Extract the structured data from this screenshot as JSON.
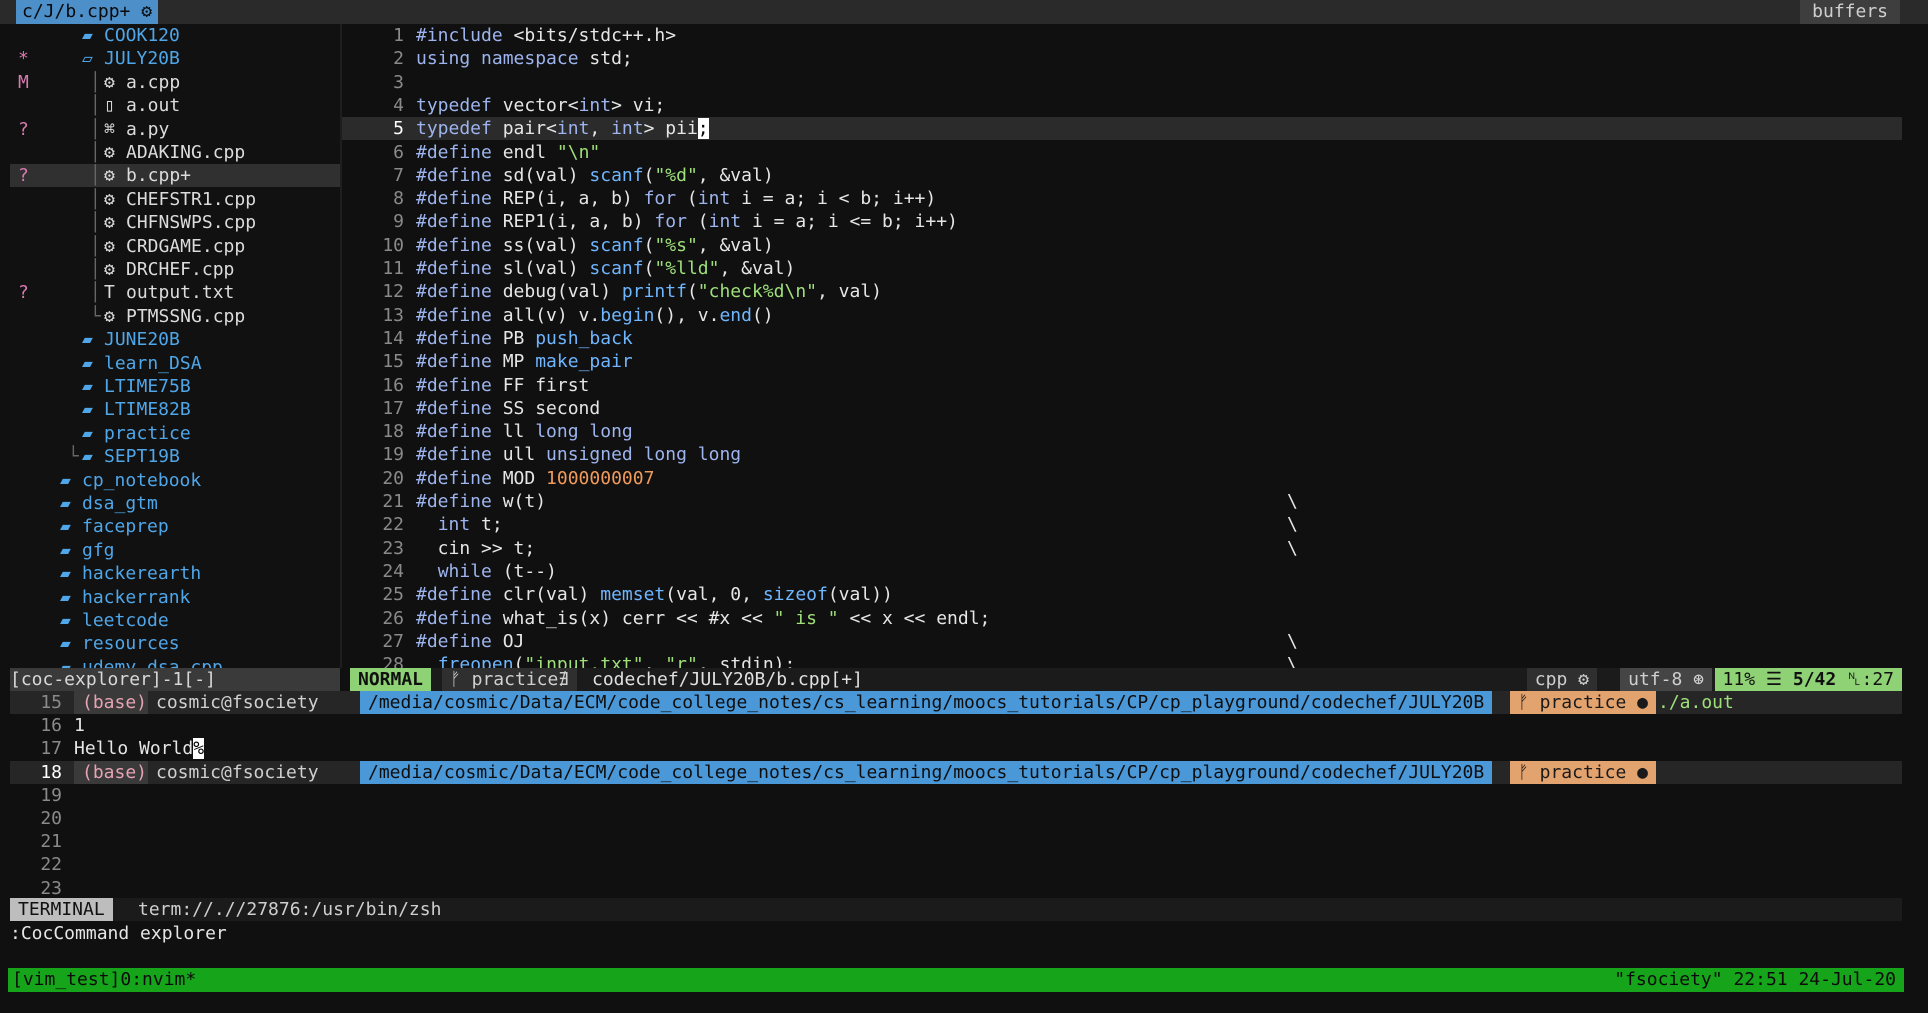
{
  "tabline": {
    "active_tab": "c/J/b.cpp+",
    "right_label": "buffers"
  },
  "explorer": {
    "rows": [
      {
        "flag": "",
        "indent": 2,
        "guide": "",
        "icon": "folder",
        "name": "COOK120",
        "selected": false
      },
      {
        "flag": "*",
        "indent": 2,
        "guide": "",
        "icon": "folder-open",
        "name": "JULY20B",
        "selected": false
      },
      {
        "flag": "M",
        "indent": 3,
        "guide": "│",
        "icon": "cpp",
        "name": "a.cpp",
        "selected": false
      },
      {
        "flag": "",
        "indent": 3,
        "guide": "│",
        "icon": "file",
        "name": "a.out",
        "selected": false
      },
      {
        "flag": "?",
        "indent": 3,
        "guide": "│",
        "icon": "python",
        "name": "a.py",
        "selected": false
      },
      {
        "flag": "",
        "indent": 3,
        "guide": "│",
        "icon": "cpp",
        "name": "ADAKING.cpp",
        "selected": false
      },
      {
        "flag": "?",
        "indent": 3,
        "guide": "│",
        "icon": "cpp",
        "name": "b.cpp+",
        "selected": true
      },
      {
        "flag": "",
        "indent": 3,
        "guide": "│",
        "icon": "cpp",
        "name": "CHEFSTR1.cpp",
        "selected": false
      },
      {
        "flag": "",
        "indent": 3,
        "guide": "│",
        "icon": "cpp",
        "name": "CHFNSWPS.cpp",
        "selected": false
      },
      {
        "flag": "",
        "indent": 3,
        "guide": "│",
        "icon": "cpp",
        "name": "CRDGAME.cpp",
        "selected": false
      },
      {
        "flag": "",
        "indent": 3,
        "guide": "│",
        "icon": "cpp",
        "name": "DRCHEF.cpp",
        "selected": false
      },
      {
        "flag": "?",
        "indent": 3,
        "guide": "│",
        "icon": "text",
        "name": "output.txt",
        "selected": false
      },
      {
        "flag": "",
        "indent": 3,
        "guide": "└",
        "icon": "cpp",
        "name": "PTMSSNG.cpp",
        "selected": false
      },
      {
        "flag": "",
        "indent": 2,
        "guide": "",
        "icon": "folder",
        "name": "JUNE20B",
        "selected": false
      },
      {
        "flag": "",
        "indent": 2,
        "guide": "",
        "icon": "folder",
        "name": "learn_DSA",
        "selected": false
      },
      {
        "flag": "",
        "indent": 2,
        "guide": "",
        "icon": "folder",
        "name": "LTIME75B",
        "selected": false
      },
      {
        "flag": "",
        "indent": 2,
        "guide": "",
        "icon": "folder",
        "name": "LTIME82B",
        "selected": false
      },
      {
        "flag": "",
        "indent": 2,
        "guide": "",
        "icon": "folder",
        "name": "practice",
        "selected": false
      },
      {
        "flag": "",
        "indent": 2,
        "guide": "└",
        "icon": "folder",
        "name": "SEPT19B",
        "selected": false
      },
      {
        "flag": "",
        "indent": 1,
        "guide": "",
        "icon": "folder",
        "name": "cp_notebook",
        "selected": false
      },
      {
        "flag": "",
        "indent": 1,
        "guide": "",
        "icon": "folder",
        "name": "dsa_gtm",
        "selected": false
      },
      {
        "flag": "",
        "indent": 1,
        "guide": "",
        "icon": "folder",
        "name": "faceprep",
        "selected": false
      },
      {
        "flag": "",
        "indent": 1,
        "guide": "",
        "icon": "folder",
        "name": "gfg",
        "selected": false
      },
      {
        "flag": "",
        "indent": 1,
        "guide": "",
        "icon": "folder",
        "name": "hackerearth",
        "selected": false
      },
      {
        "flag": "",
        "indent": 1,
        "guide": "",
        "icon": "folder",
        "name": "hackerrank",
        "selected": false
      },
      {
        "flag": "",
        "indent": 1,
        "guide": "",
        "icon": "folder",
        "name": "leetcode",
        "selected": false
      },
      {
        "flag": "",
        "indent": 1,
        "guide": "",
        "icon": "folder",
        "name": "resources",
        "selected": false
      },
      {
        "flag": "",
        "indent": 1,
        "guide": "",
        "icon": "folder",
        "name": "udemy_dsa_cpp",
        "selected": false
      }
    ]
  },
  "editor": {
    "current_line": 5,
    "lines": [
      {
        "n": 1,
        "text": "#include <bits/stdc++.h>",
        "bs": ""
      },
      {
        "n": 2,
        "text": "using namespace std;",
        "bs": ""
      },
      {
        "n": 3,
        "text": "",
        "bs": ""
      },
      {
        "n": 4,
        "text": "typedef vector<int> vi;",
        "bs": ""
      },
      {
        "n": 5,
        "text": "typedef pair<int, int> pii;",
        "bs": ""
      },
      {
        "n": 6,
        "text": "#define endl \"\\n\"",
        "bs": ""
      },
      {
        "n": 7,
        "text": "#define sd(val) scanf(\"%d\", &val)",
        "bs": ""
      },
      {
        "n": 8,
        "text": "#define REP(i, a, b) for (int i = a; i < b; i++)",
        "bs": ""
      },
      {
        "n": 9,
        "text": "#define REP1(i, a, b) for (int i = a; i <= b; i++)",
        "bs": ""
      },
      {
        "n": 10,
        "text": "#define ss(val) scanf(\"%s\", &val)",
        "bs": ""
      },
      {
        "n": 11,
        "text": "#define sl(val) scanf(\"%lld\", &val)",
        "bs": ""
      },
      {
        "n": 12,
        "text": "#define debug(val) printf(\"check%d\\n\", val)",
        "bs": ""
      },
      {
        "n": 13,
        "text": "#define all(v) v.begin(), v.end()",
        "bs": ""
      },
      {
        "n": 14,
        "text": "#define PB push_back",
        "bs": ""
      },
      {
        "n": 15,
        "text": "#define MP make_pair",
        "bs": ""
      },
      {
        "n": 16,
        "text": "#define FF first",
        "bs": ""
      },
      {
        "n": 17,
        "text": "#define SS second",
        "bs": ""
      },
      {
        "n": 18,
        "text": "#define ll long long",
        "bs": ""
      },
      {
        "n": 19,
        "text": "#define ull unsigned long long",
        "bs": ""
      },
      {
        "n": 20,
        "text": "#define MOD 1000000007",
        "bs": ""
      },
      {
        "n": 21,
        "text": "#define w(t)",
        "bs": "\\"
      },
      {
        "n": 22,
        "text": "  int t;",
        "bs": "\\"
      },
      {
        "n": 23,
        "text": "  cin >> t;",
        "bs": "\\"
      },
      {
        "n": 24,
        "text": "  while (t--)",
        "bs": ""
      },
      {
        "n": 25,
        "text": "#define clr(val) memset(val, 0, sizeof(val))",
        "bs": ""
      },
      {
        "n": 26,
        "text": "#define what_is(x) cerr << #x << \" is \" << x << endl;",
        "bs": ""
      },
      {
        "n": 27,
        "text": "#define OJ",
        "bs": "\\"
      },
      {
        "n": 28,
        "text": "  freopen(\"input.txt\", \"r\", stdin);",
        "bs": "\\"
      }
    ]
  },
  "explorer_status": "[coc-explorer]-1[-]",
  "statusline": {
    "mode": "NORMAL",
    "branch": "ᚠ practice",
    "branch_flag": "∄",
    "filepath": "codechef/JULY20B/b.cpp[+]",
    "filetype": "cpp",
    "encoding": "utf-8",
    "percent": "11%",
    "line_pos": "5/42",
    "col_pos": ":27"
  },
  "terminal": {
    "lines": [
      {
        "n": "15",
        "kind": "prompt",
        "env": "(base)",
        "host": "cosmic@fsociety",
        "cwd": "/media/cosmic/Data/ECM/code_college_notes/cs_learning/moocs_tutorials/CP/cp_playground/codechef/JULY20B",
        "git": "ᚠ practice ●",
        "cmd": "./a.out"
      },
      {
        "n": "16",
        "kind": "text",
        "text": "1"
      },
      {
        "n": "17",
        "kind": "text",
        "text": "Hello World",
        "mark": "%"
      },
      {
        "n": "18",
        "kind": "prompt",
        "env": "(base)",
        "host": "cosmic@fsociety",
        "cwd": "/media/cosmic/Data/ECM/code_college_notes/cs_learning/moocs_tutorials/CP/cp_playground/codechef/JULY20B",
        "git": "ᚠ practice ●",
        "cmd": ""
      },
      {
        "n": "19",
        "kind": "text",
        "text": ""
      },
      {
        "n": "20",
        "kind": "text",
        "text": ""
      },
      {
        "n": "21",
        "kind": "text",
        "text": ""
      },
      {
        "n": "22",
        "kind": "text",
        "text": ""
      },
      {
        "n": "23",
        "kind": "text",
        "text": ""
      }
    ],
    "current_line": "18"
  },
  "term_status": {
    "mode": "TERMINAL",
    "path": "term://.//27876:/usr/bin/zsh"
  },
  "cmdline": ":CocCommand explorer",
  "tmux": {
    "left": "[vim_test]0:nvim*",
    "right": "\"fsociety\" 22:51 24-Jul-20"
  },
  "colors": {
    "mode_green": "#8fd175",
    "folder_blue": "#4fa6e8",
    "tmux_green": "#16a51a",
    "cwd_blue": "#4a98d8",
    "git_orange": "#e3a36e"
  }
}
